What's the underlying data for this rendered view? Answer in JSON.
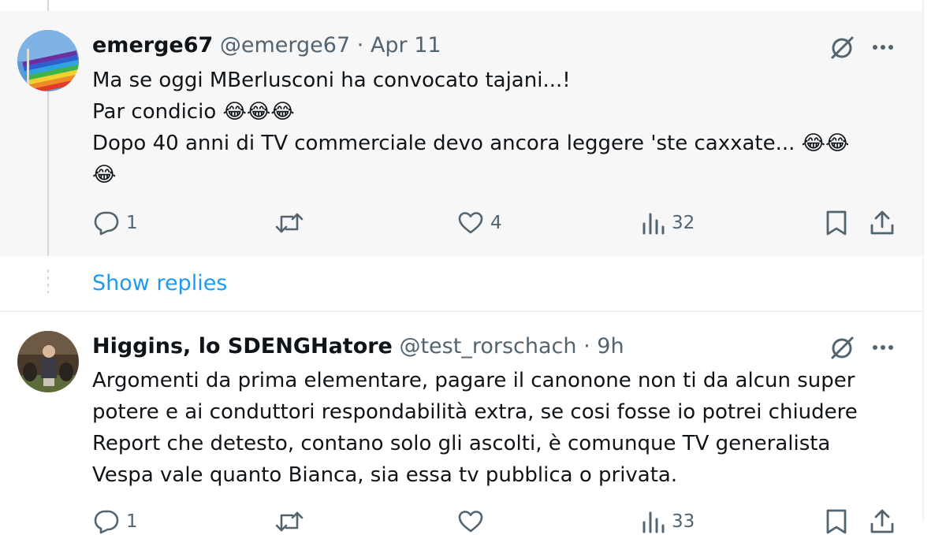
{
  "tweets": [
    {
      "name": "emerge67",
      "handle": "@emerge67",
      "separator": "·",
      "time": "Apr 11",
      "text": "Ma se oggi MBerlusconi ha convocato tajani...!\nPar condicio 😂😂😂\nDopo 40 anni di TV commerciale devo ancora leggere 'ste caxxate... 😂😂\n😂",
      "reply_count": "1",
      "retweet_count": "",
      "like_count": "4",
      "view_count": "32"
    },
    {
      "name": "Higgins, lo SDENGHatore",
      "handle": "@test_rorschach",
      "separator": "·",
      "time": "9h",
      "text": "Argomenti da prima elementare, pagare il canonone non ti da alcun super\npotere e ai conduttori respondabilità extra, se cosi fosse io potrei chiudere\nReport che detesto, contano solo gli ascolti, è comunque TV generalista\nVespa vale quanto Bianca, sia essa tv pubblica o privata.",
      "reply_count": "1",
      "retweet_count": "",
      "like_count": "",
      "view_count": "33"
    }
  ],
  "show_replies": "Show replies",
  "colors": {
    "accent": "#1d9bf0",
    "muted": "#536471",
    "text": "#0f1419",
    "highlight_bg": "#f7f7f7"
  }
}
